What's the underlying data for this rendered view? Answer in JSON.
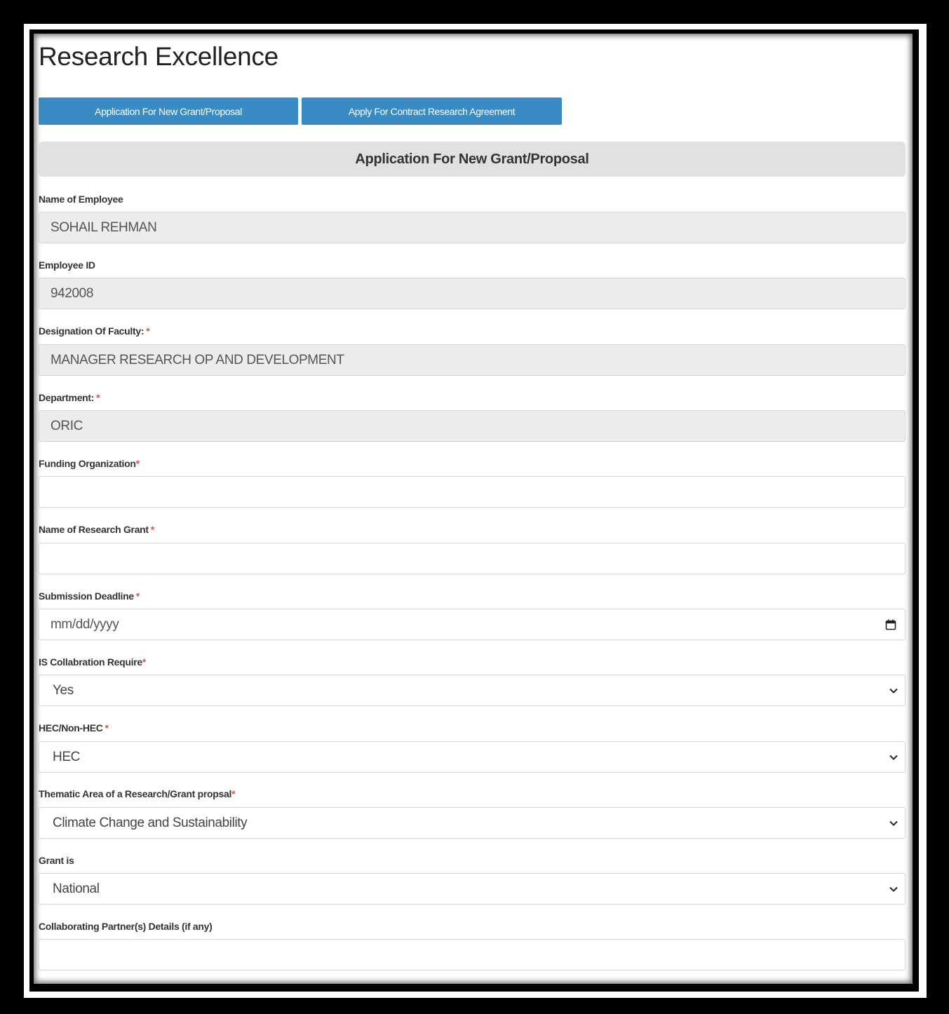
{
  "page_title": "Research Excellence",
  "tabs": [
    {
      "label": "Application For New Grant/Proposal"
    },
    {
      "label": "Apply For Contract Research Agreement"
    }
  ],
  "section_title": "Application For New Grant/Proposal",
  "required_marker": "*",
  "fields": {
    "employee_name": {
      "label": "Name of Employee",
      "value": "SOHAIL REHMAN"
    },
    "employee_id": {
      "label": "Employee ID",
      "value": "942008"
    },
    "designation": {
      "label": "Designation Of Faculty:",
      "value": "MANAGER RESEARCH OP AND DEVELOPMENT"
    },
    "department": {
      "label": "Department:",
      "value": "ORIC"
    },
    "funding_org": {
      "label": "Funding Organization",
      "value": ""
    },
    "grant_name": {
      "label": "Name of Research Grant",
      "value": ""
    },
    "deadline": {
      "label": "Submission Deadline",
      "placeholder": "mm/dd/yyyy"
    },
    "collaboration": {
      "label": "IS Collabration Require",
      "selected": "Yes"
    },
    "hec": {
      "label": "HEC/Non-HEC",
      "selected": "HEC"
    },
    "thematic_area": {
      "label": "Thematic Area of a Research/Grant propsal",
      "selected": "Climate Change and Sustainability"
    },
    "grant_is": {
      "label": "Grant is",
      "selected": "National"
    },
    "partners": {
      "label": "Collaborating Partner(s) Details (if any)",
      "value": ""
    }
  },
  "colors": {
    "tab_button": "#3a8bc4",
    "section_header": "#e2e0e1",
    "readonly_field": "#ececec",
    "required": "#d9534f"
  },
  "icons": {
    "calendar": "calendar-icon",
    "dropdown": "chevron-down-icon"
  }
}
